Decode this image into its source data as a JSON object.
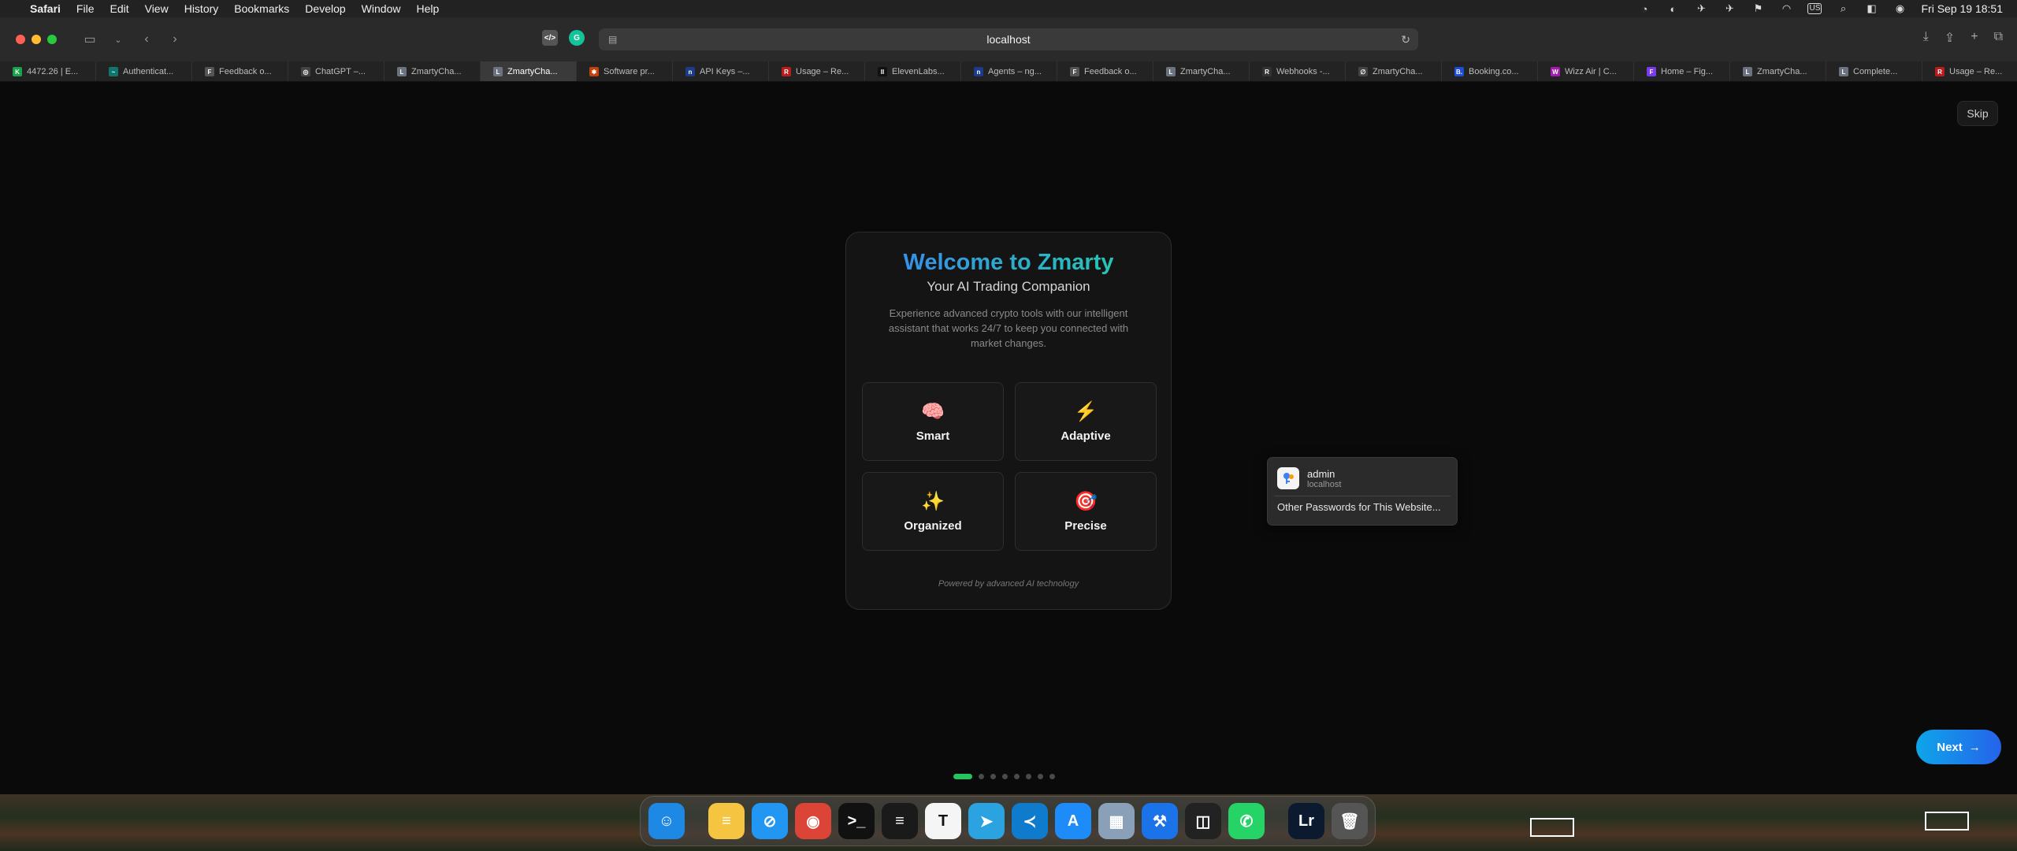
{
  "menubar": {
    "app": "Safari",
    "items": [
      "File",
      "Edit",
      "View",
      "History",
      "Bookmarks",
      "Develop",
      "Window",
      "Help"
    ],
    "input_source": "US",
    "clock": "Fri Sep 19  18:51"
  },
  "toolbar": {
    "url": "localhost"
  },
  "tabs": [
    {
      "title": "4472.26 | E...",
      "color": "#16a34a",
      "glyph": "K"
    },
    {
      "title": "Authenticat...",
      "color": "#0f766e",
      "glyph": "~"
    },
    {
      "title": "Feedback o...",
      "color": "#555555",
      "glyph": "F"
    },
    {
      "title": "ChatGPT –...",
      "color": "#444444",
      "glyph": "◎"
    },
    {
      "title": "ZmartyCha...",
      "color": "#6b7280",
      "glyph": "L"
    },
    {
      "title": "ZmartyCha...",
      "color": "#6b7280",
      "glyph": "L",
      "active": true
    },
    {
      "title": "Software pr...",
      "color": "#c2410c",
      "glyph": "✱"
    },
    {
      "title": "API Keys –...",
      "color": "#1e3a8a",
      "glyph": "n"
    },
    {
      "title": "Usage – Re...",
      "color": "#b91c1c",
      "glyph": "R"
    },
    {
      "title": "ElevenLabs...",
      "color": "#111111",
      "glyph": "II"
    },
    {
      "title": "Agents – ng...",
      "color": "#1e3a8a",
      "glyph": "n"
    },
    {
      "title": "Feedback o...",
      "color": "#555555",
      "glyph": "F"
    },
    {
      "title": "ZmartyCha...",
      "color": "#6b7280",
      "glyph": "L"
    },
    {
      "title": "Webhooks -...",
      "color": "#333333",
      "glyph": "R"
    },
    {
      "title": "ZmartyCha...",
      "color": "#444444",
      "glyph": "∅"
    },
    {
      "title": "Booking.co...",
      "color": "#1d4ed8",
      "glyph": "B."
    },
    {
      "title": "Wizz Air | C...",
      "color": "#a21caf",
      "glyph": "W"
    },
    {
      "title": "Home – Fig...",
      "color": "#7c3aed",
      "glyph": "F"
    },
    {
      "title": "ZmartyCha...",
      "color": "#6b7280",
      "glyph": "L"
    },
    {
      "title": "Complete...",
      "color": "#6b7280",
      "glyph": "L"
    },
    {
      "title": "Usage – Re...",
      "color": "#b91c1c",
      "glyph": "R"
    }
  ],
  "page": {
    "skip_label": "Skip",
    "title": "Welcome to Zmarty",
    "subtitle": "Your AI Trading Companion",
    "description": "Experience advanced crypto tools with our intelligent assistant that works 24/7 to keep you connected with market changes.",
    "features": [
      {
        "emoji": "🧠",
        "label": "Smart",
        "icon": "brain-icon"
      },
      {
        "emoji": "⚡",
        "label": "Adaptive",
        "icon": "lightning-icon"
      },
      {
        "emoji": "✨",
        "label": "Organized",
        "icon": "sparkles-icon"
      },
      {
        "emoji": "🎯",
        "label": "Precise",
        "icon": "target-icon"
      }
    ],
    "powered_by": "Powered by advanced AI technology",
    "next_label": "Next",
    "next_arrow": "→",
    "step_current": 1,
    "step_total": 8
  },
  "password_popup": {
    "username": "admin",
    "site": "localhost",
    "other": "Other Passwords for This Website..."
  },
  "dock": {
    "apps": [
      {
        "name": "finder-icon",
        "color": "#1e88e5",
        "glyph": "☺"
      },
      {
        "name": "notes-icon",
        "color": "#f5c542",
        "glyph": "≡"
      },
      {
        "name": "safari-icon",
        "color": "#2196f3",
        "glyph": "⊘"
      },
      {
        "name": "chrome-icon",
        "color": "#db4437",
        "glyph": "◉"
      },
      {
        "name": "terminal-icon",
        "color": "#111111",
        "glyph": ">_"
      },
      {
        "name": "todoist-icon",
        "color": "#1a1a1a",
        "glyph": "≡"
      },
      {
        "name": "typora-icon",
        "color": "#f5f5f5",
        "glyph": "T"
      },
      {
        "name": "telegram-icon",
        "color": "#2aa3e0",
        "glyph": "➤"
      },
      {
        "name": "vscode-icon",
        "color": "#0f7bcc",
        "glyph": "≺"
      },
      {
        "name": "app-store-icon",
        "color": "#1d8cf8",
        "glyph": "A"
      },
      {
        "name": "preview-icon",
        "color": "#8aa0b8",
        "glyph": "▦"
      },
      {
        "name": "xcode-icon",
        "color": "#1a73e8",
        "glyph": "⚒"
      },
      {
        "name": "cube-app-icon",
        "color": "#222222",
        "glyph": "◫"
      },
      {
        "name": "whatsapp-icon",
        "color": "#25d366",
        "glyph": "✆"
      }
    ],
    "apps_right": [
      {
        "name": "lightroom-icon",
        "color": "#0b1a2f",
        "glyph": "Lr"
      },
      {
        "name": "trash-icon",
        "color": "#555555",
        "glyph": "🗑"
      }
    ]
  },
  "colors": {
    "accent_green": "#22c55e",
    "next_gradient_start": "#0ea5e9",
    "next_gradient_end": "#2563eb",
    "title_gradient_start": "#3b82f6",
    "title_gradient_end": "#22d3a6"
  }
}
